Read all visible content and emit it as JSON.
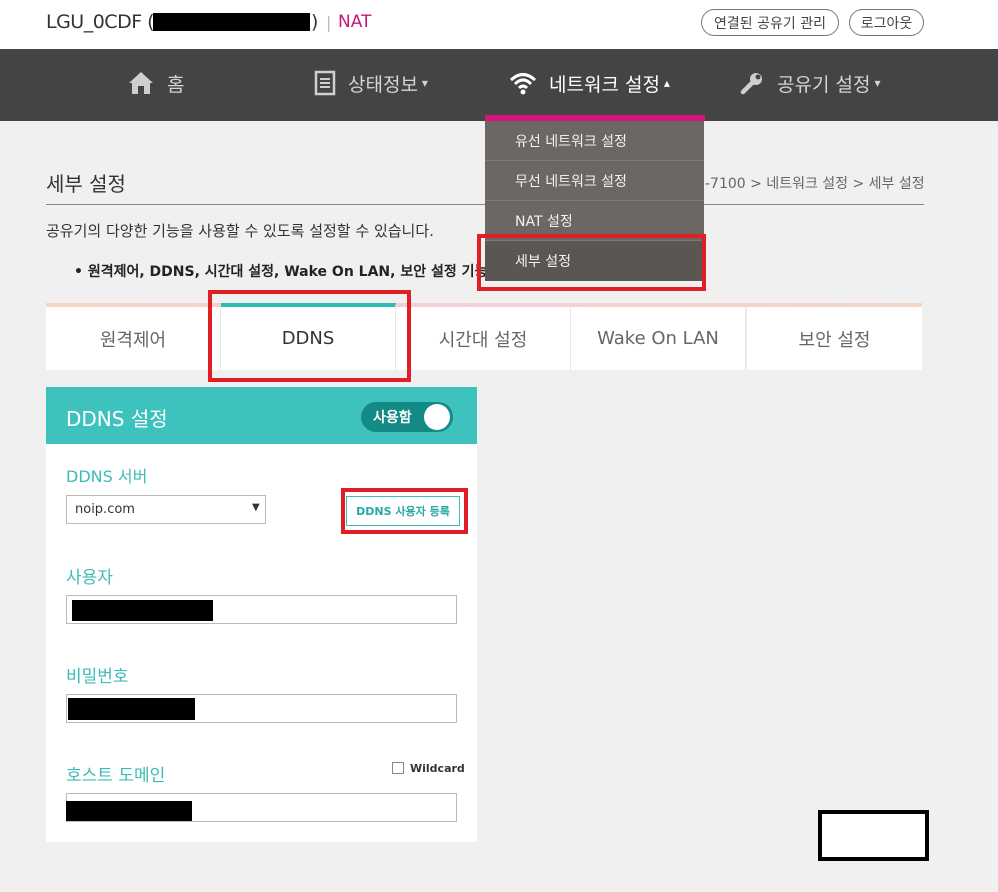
{
  "header": {
    "device_name": "LGU_0CDF (",
    "device_paren_close": ")",
    "pipe": "|",
    "mode": "NAT",
    "manage_button": "연결된 공유기 관리",
    "logout_button": "로그아웃"
  },
  "nav": {
    "items": [
      {
        "label": "홈",
        "icon": "home-icon"
      },
      {
        "label": "상태정보",
        "icon": "document-icon",
        "caret": "▾"
      },
      {
        "label": "네트워크 설정",
        "icon": "wifi-icon",
        "caret": "▴"
      },
      {
        "label": "공유기 설정",
        "icon": "wrench-icon",
        "caret": "▾"
      }
    ],
    "active_index": 2,
    "accent_color": "#d6157b"
  },
  "dropdown": {
    "items": [
      "유선 네트워크 설정",
      "무선 네트워크 설정",
      "NAT 설정",
      "세부 설정"
    ],
    "selected": "세부 설정"
  },
  "page": {
    "title": "세부 설정",
    "breadcrumb": "-7100 > 네트워크 설정 > 세부 설정",
    "description": "공유기의 다양한 기능을 사용할 수 있도록 설정할 수 있습니다.",
    "bullet": "• 원격제어, DDNS, 시간대 설정, Wake On LAN, 보안 설정 기능을"
  },
  "tabs": [
    "원격제어",
    "DDNS",
    "시간대 설정",
    "Wake On LAN",
    "보안 설정"
  ],
  "active_tab": "DDNS",
  "ddns": {
    "title": "DDNS 설정",
    "toggle_label": "사용함",
    "toggle_on": true,
    "accent_color": "#3dc2be",
    "server_label": "DDNS 서버",
    "server_value": "noip.com",
    "register_button": "DDNS 사용자 등록",
    "user_label": "사용자",
    "password_label": "비밀번호",
    "host_label": "호스트 도메인",
    "wildcard_label": "Wildcard",
    "wildcard_checked": false
  }
}
